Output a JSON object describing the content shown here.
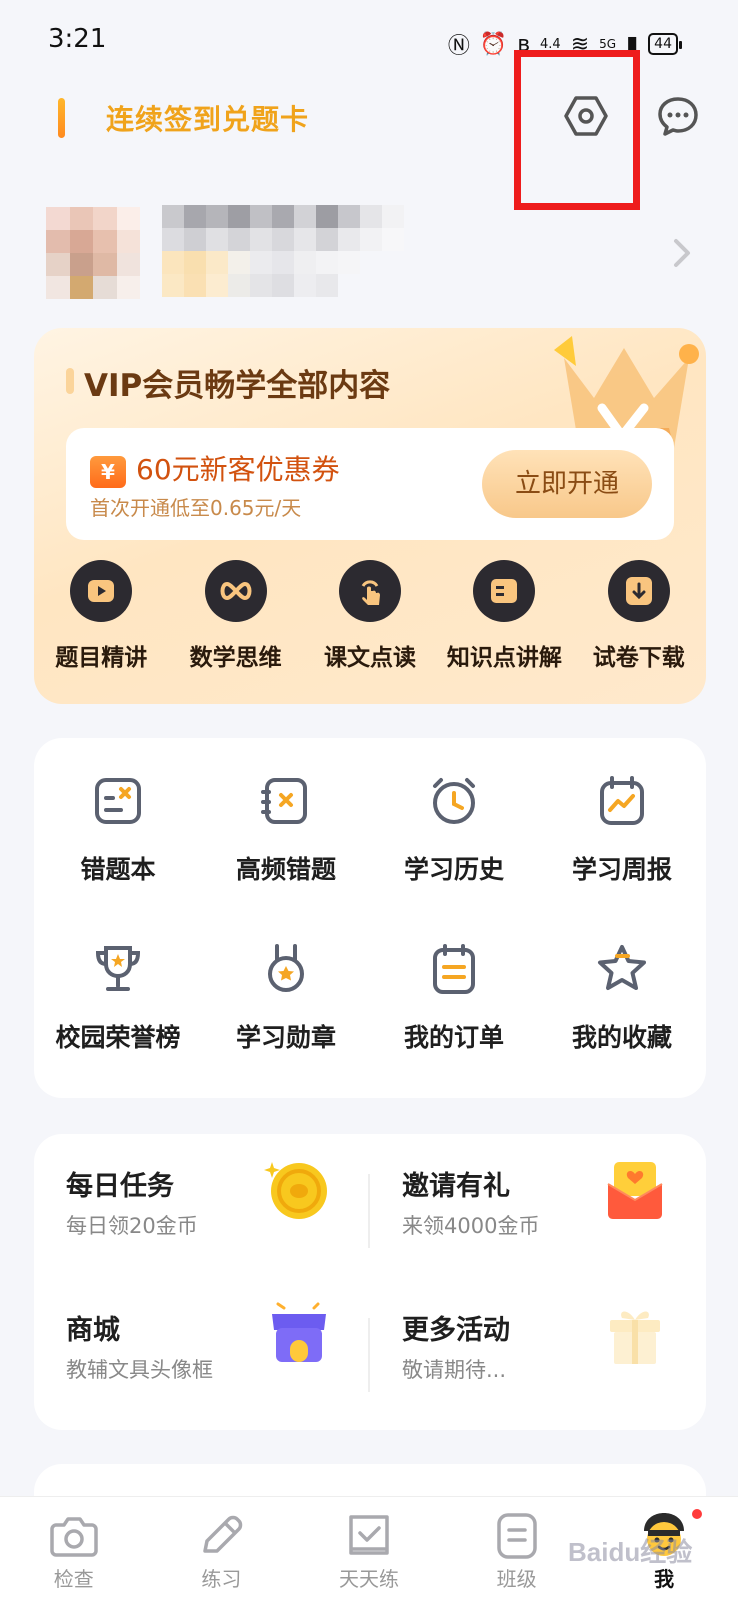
{
  "status_bar": {
    "time": "3:21",
    "speed": "4.4",
    "network": "5G",
    "battery": "44"
  },
  "header": {
    "checkin_text": "连续签到兑题卡",
    "settings_icon": "hexagon-gear-icon",
    "message_icon": "chat-bubble-icon"
  },
  "vip": {
    "title": "VIP会员畅学全部内容",
    "coupon_badge": "¥",
    "coupon_title": "60元新客优惠券",
    "coupon_sub": "首次开通低至0.65元/天",
    "open_button": "立即开通",
    "features": [
      {
        "label": "题目精讲",
        "icon": "play-icon"
      },
      {
        "label": "数学思维",
        "icon": "infinity-icon"
      },
      {
        "label": "课文点读",
        "icon": "tap-icon"
      },
      {
        "label": "知识点讲解",
        "icon": "card-icon"
      },
      {
        "label": "试卷下载",
        "icon": "download-icon"
      }
    ]
  },
  "tools": [
    {
      "label": "错题本",
      "icon": "wrong-book-icon"
    },
    {
      "label": "高频错题",
      "icon": "frequent-wrong-icon"
    },
    {
      "label": "学习历史",
      "icon": "clock-icon"
    },
    {
      "label": "学习周报",
      "icon": "weekly-report-icon"
    },
    {
      "label": "校园荣誉榜",
      "icon": "trophy-icon"
    },
    {
      "label": "学习勋章",
      "icon": "medal-icon"
    },
    {
      "label": "我的订单",
      "icon": "order-icon"
    },
    {
      "label": "我的收藏",
      "icon": "star-icon"
    }
  ],
  "activities": [
    {
      "title": "每日任务",
      "sub": "每日领20金币",
      "icon": "gold-coin-icon"
    },
    {
      "title": "邀请有礼",
      "sub": "来领4000金币",
      "icon": "envelope-icon"
    },
    {
      "title": "商城",
      "sub": "教辅文具头像框",
      "icon": "shop-icon"
    },
    {
      "title": "更多活动",
      "sub": "敬请期待...",
      "icon": "gift-icon"
    }
  ],
  "bottom_nav": [
    {
      "label": "检查",
      "icon": "camera-icon"
    },
    {
      "label": "练习",
      "icon": "pencil-icon"
    },
    {
      "label": "天天练",
      "icon": "calendar-check-icon"
    },
    {
      "label": "班级",
      "icon": "class-icon"
    },
    {
      "label": "我",
      "icon": "mascot-avatar-icon"
    }
  ],
  "watermark": "Baidu经验",
  "colors": {
    "accent_orange": "#f0a31b",
    "highlight_red": "#ee1c1c",
    "vip_brown": "#6b3a12",
    "icon_gray": "#5b6170",
    "icon_orange": "#f5a623"
  }
}
